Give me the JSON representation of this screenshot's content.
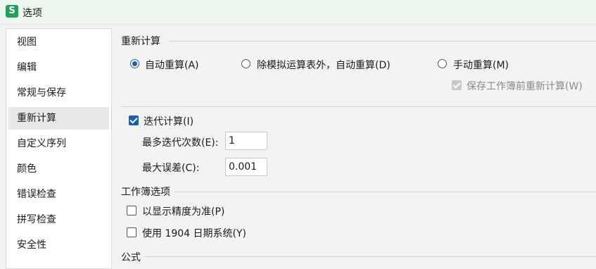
{
  "window": {
    "app_icon": "S",
    "title": "选项"
  },
  "sidebar": {
    "items": [
      {
        "label": "视图"
      },
      {
        "label": "编辑"
      },
      {
        "label": "常规与保存"
      },
      {
        "label": "重新计算"
      },
      {
        "label": "自定义序列"
      },
      {
        "label": "颜色"
      },
      {
        "label": "错误检查"
      },
      {
        "label": "拼写检查"
      },
      {
        "label": "安全性"
      }
    ],
    "active_index": 3
  },
  "recalc": {
    "section_title": "重新计算",
    "radio_auto": "自动重算(A)",
    "radio_auto_except": "除模拟运算表外，自动重算(D)",
    "radio_manual": "手动重算(M)",
    "selected": "auto",
    "save_before_label": "保存工作簿前重新计算(W)",
    "save_before_checked": true,
    "save_before_enabled": false
  },
  "iteration": {
    "label": "迭代计算(I)",
    "checked": true,
    "max_iter_label": "最多迭代次数(E):",
    "max_iter_value": "1",
    "max_change_label": "最大误差(C):",
    "max_change_value": "0.001"
  },
  "workbook": {
    "section_title": "工作簿选项",
    "precision_label": "以显示精度为准(P)",
    "precision_checked": false,
    "date1904_label": "使用 1904 日期系统(Y)",
    "date1904_checked": false
  },
  "formula": {
    "section_title": "公式"
  },
  "colors": {
    "accent": "#1a5fb4",
    "app_green": "#20a05a",
    "titlebar_bg": "#eef7ee"
  }
}
